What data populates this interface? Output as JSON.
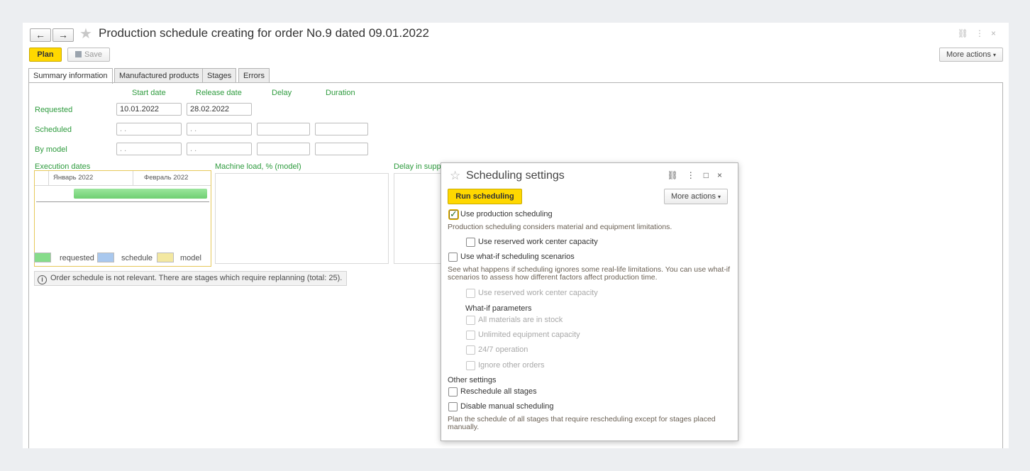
{
  "window": {
    "title": "Production schedule creating for order No.9 dated 09.01.2022",
    "back_glyph": "←",
    "forward_glyph": "→"
  },
  "toolbar": {
    "plan_label": "Plan",
    "save_label": "Save",
    "more_actions_label": "More actions"
  },
  "tabs": [
    {
      "label": "Summary information"
    },
    {
      "label": "Manufactured products"
    },
    {
      "label": "Stages"
    },
    {
      "label": "Errors"
    }
  ],
  "summary": {
    "col_start": "Start date",
    "col_release": "Release date",
    "col_delay": "Delay",
    "col_duration": "Duration",
    "row_requested": "Requested",
    "row_scheduled": "Scheduled",
    "row_model": "By model",
    "requested_start": "10.01.2022",
    "requested_release": "28.02.2022",
    "empty_date": " .  . "
  },
  "execution": {
    "label": "Execution dates",
    "month1": "Январь 2022",
    "month2": "Февраль 2022",
    "machine_load_label": "Machine load, % (model)",
    "delay_label": "Delay in supp"
  },
  "legend": {
    "requested": "requested",
    "schedule": "schedule",
    "model": "model",
    "colors": {
      "requested": "#86dc8a",
      "schedule": "#a9c8ee",
      "model": "#f3e8a1"
    }
  },
  "info_text": "Order schedule is not relevant. There are stages which require replanning (total: 25).",
  "dialog": {
    "title": "Scheduling settings",
    "run_label": "Run scheduling",
    "more_actions_label": "More actions",
    "use_production_scheduling": "Use production scheduling",
    "production_note": "Production scheduling considers material and equipment limitations.",
    "use_reserved_1": "Use reserved work center capacity",
    "use_whatif": "Use what-if scheduling scenarios",
    "whatif_note": "See what happens if scheduling ignores some real-life limitations. You can use what-if scenarios to assess how different factors affect production time.",
    "use_reserved_2": "Use reserved work center capacity",
    "whatif_params_label": "What-if parameters",
    "all_materials": "All materials are in stock",
    "unlimited_equipment": "Unlimited equipment capacity",
    "operation_247": "24/7 operation",
    "ignore_orders": "Ignore other orders",
    "other_settings_label": "Other settings",
    "reschedule_all": "Reschedule all stages",
    "disable_manual": "Disable manual scheduling",
    "manual_note": "Plan the schedule of all stages that require rescheduling except for stages placed manually."
  }
}
